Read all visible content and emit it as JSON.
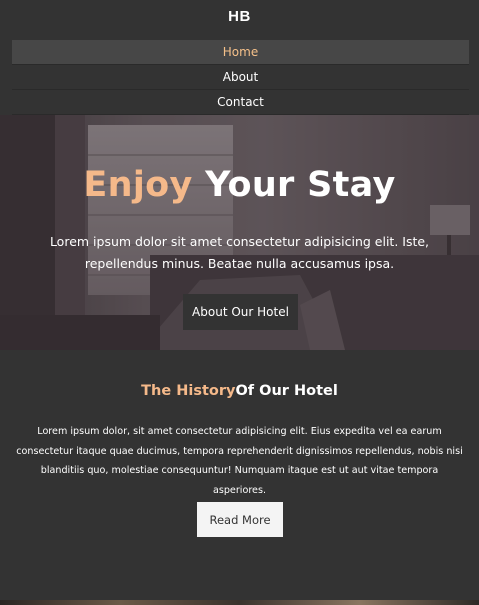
{
  "brand": "HB",
  "nav": {
    "items": [
      {
        "label": "Home",
        "active": true
      },
      {
        "label": "About",
        "active": false
      },
      {
        "label": "Contact",
        "active": false
      }
    ]
  },
  "hero": {
    "title_accent": "Enjoy",
    "title_rest": " Your Stay",
    "text": "Lorem ipsum dolor sit amet consectetur adipisicing elit. Iste, repellendus minus. Beatae nulla accusamus ipsa.",
    "button_label": "About Our Hotel"
  },
  "history": {
    "title_accent": "The History",
    "title_rest": "Of Our Hotel",
    "text": "Lorem ipsum dolor, sit amet consectetur adipisicing elit. Eius expedita vel ea earum consectetur itaque quae ducimus, tempora reprehenderit dignissimos repellendus, nobis nisi blanditiis quo, molestiae consequuntur! Numquam itaque est ut aut vitae tempora asperiores.",
    "button_label": "Read More"
  },
  "colors": {
    "accent": "#f5b98a",
    "background": "#333333",
    "nav_active_bg": "#474747"
  }
}
